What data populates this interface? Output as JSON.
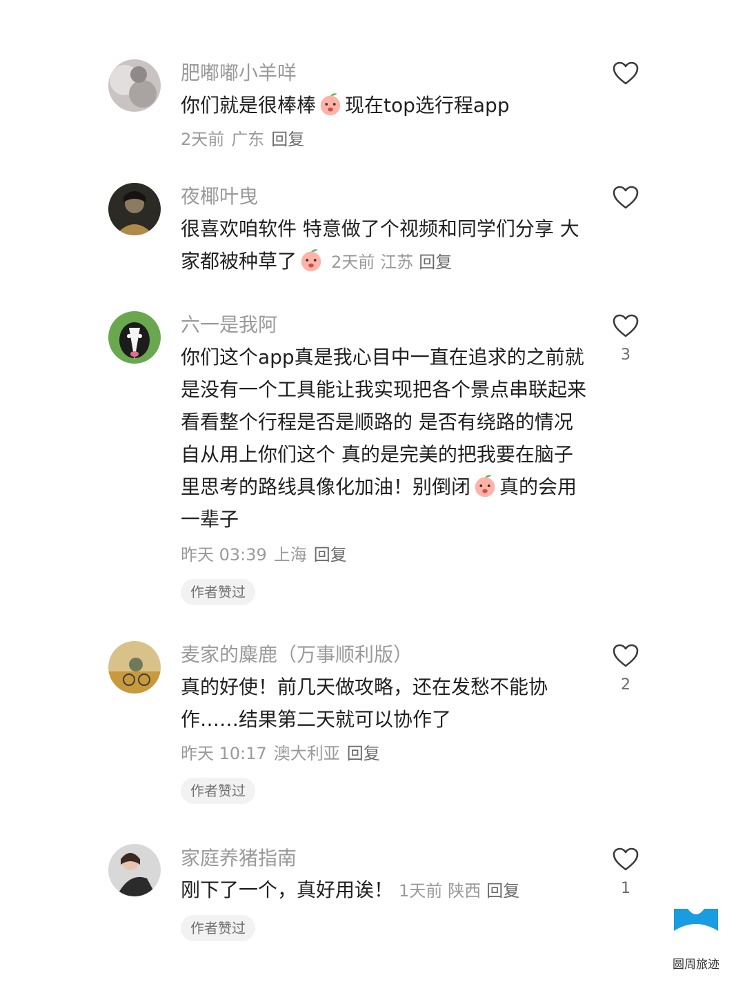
{
  "comments": [
    {
      "name": "肥嘟嘟小羊咩",
      "text_parts": [
        "你们就是很棒棒",
        "现在top选行程app"
      ],
      "time": "2天前",
      "region": "广东",
      "reply": "回复",
      "likes": "",
      "badge": ""
    },
    {
      "name": "夜椰叶曳",
      "text_parts": [
        "很喜欢咱软件 特意做了个视频和同学们分享 大家都被种草了",
        ""
      ],
      "time": "2天前",
      "region": "江苏",
      "reply": "回复",
      "likes": "",
      "badge": ""
    },
    {
      "name": "六一是我阿",
      "text_parts": [
        "你们这个app真是我心目中一直在追求的之前就是没有一个工具能让我实现把各个景点串联起来看看整个行程是否是顺路的 是否有绕路的情况 自从用上你们这个 真的是完美的把我要在脑子里思考的路线具像化加油！别倒闭",
        "真的会用一辈子"
      ],
      "time": "昨天 03:39",
      "region": "上海",
      "reply": "回复",
      "likes": "3",
      "badge": "作者赞过"
    },
    {
      "name": "麦家的麋鹿（万事顺利版）",
      "text_parts": [
        "真的好使！前几天做攻略，还在发愁不能协作……结果第二天就可以协作了",
        ""
      ],
      "time": "昨天 10:17",
      "region": "澳大利亚",
      "reply": "回复",
      "likes": "2",
      "badge": "作者赞过"
    },
    {
      "name": "家庭养猪指南",
      "text_parts": [
        "刚下了一个，真好用诶！",
        ""
      ],
      "time": "1天前",
      "region": "陕西",
      "reply": "回复",
      "likes": "1",
      "badge": "作者赞过"
    }
  ],
  "icons": {
    "like": "heart-outline-icon",
    "emoji": "peach-emoji-icon"
  },
  "brand": {
    "name": "圆周旅迹",
    "logo": "yuanzhou-logo-icon",
    "color": "#1a9ce0"
  }
}
